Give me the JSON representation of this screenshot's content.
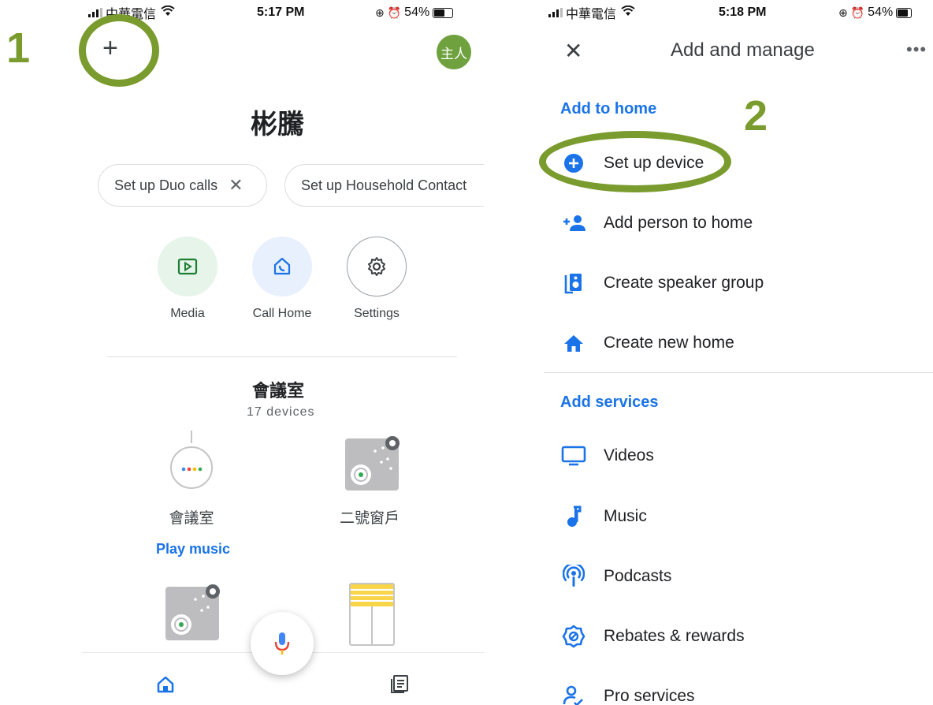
{
  "left": {
    "status": {
      "carrier": "中華電信",
      "time": "5:17 PM",
      "battery": "54%"
    },
    "step_label": "1",
    "avatar_text": "主人",
    "home_name": "彬騰",
    "chips": [
      {
        "label": "Set up Duo calls",
        "close": "✕"
      },
      {
        "label": "Set up Household Contact"
      }
    ],
    "actions": [
      {
        "label": "Media",
        "icon": "media-icon"
      },
      {
        "label": "Call Home",
        "icon": "call-home-icon"
      },
      {
        "label": "Settings",
        "icon": "settings-icon"
      }
    ],
    "room": {
      "name": "會議室",
      "count": "17 devices"
    },
    "devices": [
      {
        "label": "會議室",
        "icon": "smart-speaker-icon"
      },
      {
        "label": "二號窗戶",
        "icon": "window-sensor-icon"
      }
    ],
    "play_music": "Play music",
    "bottom_nav": [
      {
        "icon": "home-icon"
      },
      {
        "icon": "feed-icon"
      }
    ]
  },
  "right": {
    "status": {
      "carrier": "中華電信",
      "time": "5:18 PM",
      "battery": "54%"
    },
    "step_label": "2",
    "title": "Add and manage",
    "section_home": "Add to home",
    "home_items": [
      {
        "label": "Set up device",
        "icon": "add-circle-icon"
      },
      {
        "label": "Add person to home",
        "icon": "add-person-icon"
      },
      {
        "label": "Create speaker group",
        "icon": "speaker-icon"
      },
      {
        "label": "Create new home",
        "icon": "home-icon"
      }
    ],
    "section_services": "Add services",
    "service_items": [
      {
        "label": "Videos",
        "icon": "tv-icon"
      },
      {
        "label": "Music",
        "icon": "music-note-icon"
      },
      {
        "label": "Podcasts",
        "icon": "podcast-icon"
      },
      {
        "label": "Rebates & rewards",
        "icon": "rebate-icon"
      },
      {
        "label": "Pro services",
        "icon": "pro-services-icon"
      }
    ]
  },
  "colors": {
    "accent_blue": "#1a73e8",
    "highlight_green": "#7a9b2d",
    "avatar_green": "#6fa23e"
  }
}
